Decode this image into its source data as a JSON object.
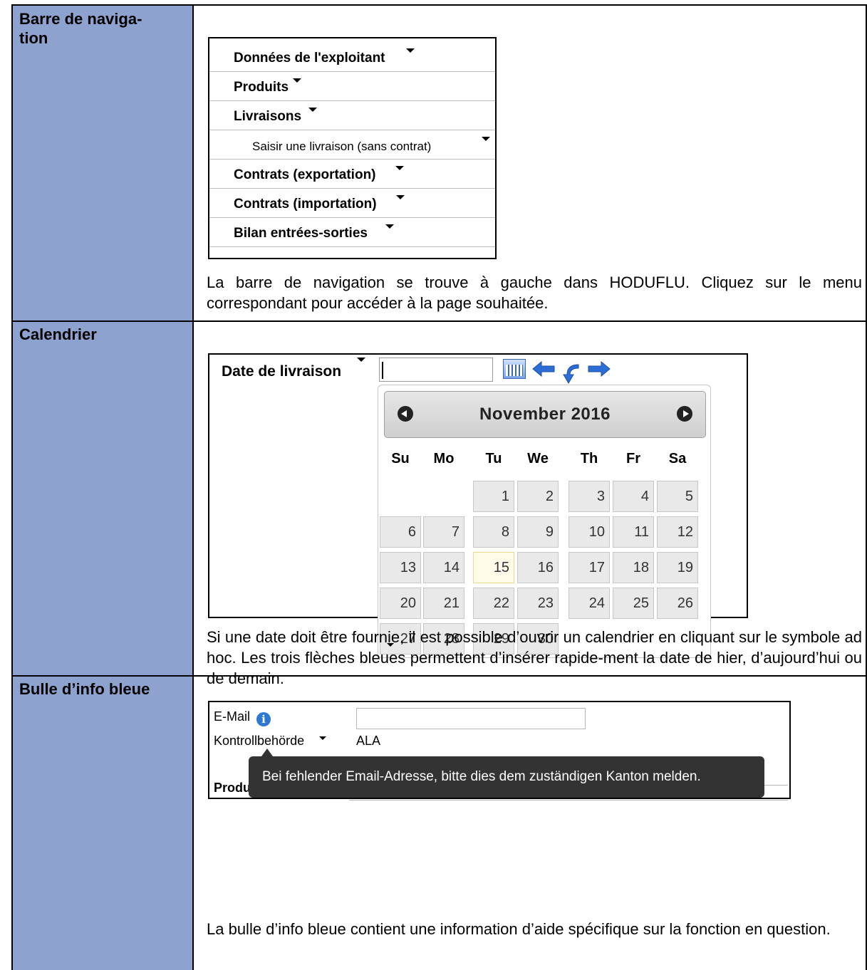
{
  "sections": {
    "nav": {
      "heading_lines": [
        "Barre de naviga-",
        "tion"
      ],
      "menu_items": [
        "Données de l'exploitant",
        "Produits",
        "Livraisons",
        "Saisir une livraison (sans contrat)",
        "Contrats (exportation)",
        "Contrats (importation)",
        "Bilan entrées-sorties"
      ],
      "paragraph": "La barre de navigation se trouve à gauche dans HODUFLU. Cliquez sur le menu correspondant pour accéder à la page souhaitée."
    },
    "calendar": {
      "heading": "Calendrier",
      "date_label": "Date de livraison",
      "date_value": "",
      "month_label": "November 2016",
      "weekdays": [
        "Su",
        "Mo",
        "Tu",
        "We",
        "Th",
        "Fr",
        "Sa"
      ],
      "days": [
        "1",
        "2",
        "3",
        "4",
        "5",
        "6",
        "7",
        "8",
        "9",
        "10",
        "11",
        "12",
        "13",
        "14",
        "15",
        "16",
        "17",
        "18",
        "19",
        "20",
        "21",
        "22",
        "23",
        "24",
        "25",
        "26",
        "27",
        "28",
        "29",
        "30"
      ],
      "today": "15",
      "paragraph": "Si une date doit être fournie, il est possible d’ouvrir un calendrier en cliquant sur le symbole ad hoc. Les trois flèches bleues permettent d’insérer rapide-ment la date de hier, d’aujourd’hui ou de demain."
    },
    "info": {
      "heading": "Bulle d’info bleue",
      "email_label": "E-Mail",
      "info_icon": "info-icon",
      "authority_label": "Kontrollbehörde",
      "authority_value": "ALA",
      "product_label": "Produkt",
      "tooltip": "Bei fehlender Email-Adresse, bitte dies dem zuständigen Kanton melden.",
      "paragraph": "La bulle d’info bleue contient une information d’aide spécifique sur la fonction en question."
    }
  },
  "colors": {
    "label_column": "#8ea2cf",
    "tooltip_bg": "#333333",
    "arrow_blue": "#2d6ed6"
  }
}
